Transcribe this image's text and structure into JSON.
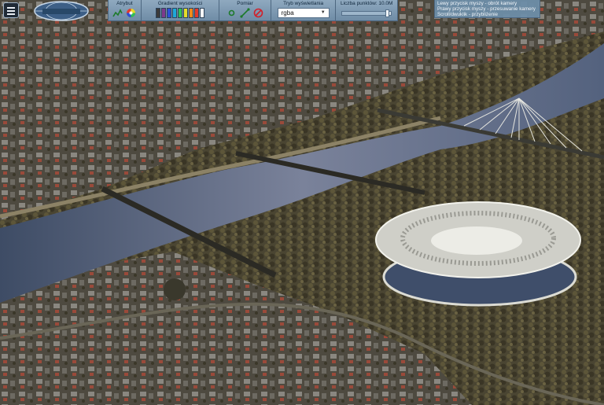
{
  "toolbar": {
    "attribute": {
      "label": "Atrybut",
      "icons": [
        "terrain-icon",
        "color-wheel-icon"
      ]
    },
    "height_gradient": {
      "label": "Gradient wysokości",
      "colors": [
        "#3a3a3a",
        "#7d3a8c",
        "#2c4fd6",
        "#1fa8d8",
        "#2fbf5a",
        "#e4dc2a",
        "#f08a1c",
        "#e33a2b",
        "#ffffff"
      ]
    },
    "measurement": {
      "label": "Pomiar",
      "icons": [
        "point-icon",
        "distance-icon",
        "cancel-icon"
      ]
    },
    "display_mode": {
      "label": "Tryb wyświetlania",
      "value": "rgba"
    },
    "point_count": {
      "label": "Liczba punktów: 10.0M",
      "fraction": 0.97
    }
  },
  "help": {
    "lines": [
      "Lewy przycisk myszy - obrót kamery",
      "Prawy przycisk myszy - przesuwanie kamery",
      "Scroll/dwuklik - przybliżenie"
    ]
  },
  "colors": {
    "toolbar": "#7f9bb3",
    "river": "#4d5c74",
    "stadium": "#e7e7e2"
  }
}
